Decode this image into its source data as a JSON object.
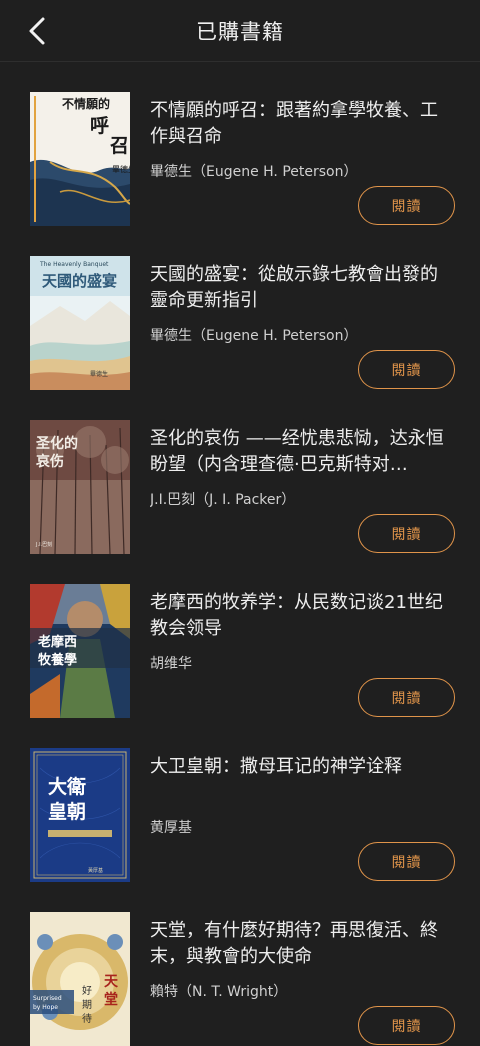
{
  "header": {
    "title": "已購書籍",
    "back_icon": "chevron-left-icon"
  },
  "colors": {
    "background": "#1f1f1f",
    "accent": "#e0944a",
    "text": "#eeeeee"
  },
  "books": [
    {
      "title": "不情願的呼召：跟著約拿學牧養、工作與召命",
      "author": "畢德生（Eugene H. Peterson）",
      "read_label": "閱讀",
      "cover_title": "不情願的呼召"
    },
    {
      "title": "天國的盛宴：從啟示錄七教會出發的靈命更新指引",
      "author": "畢德生（Eugene H. Peterson）",
      "read_label": "閱讀",
      "cover_title": "天國的盛宴",
      "cover_subtitle": "The Heavenly Banquet"
    },
    {
      "title": "圣化的哀伤 ——经忧患悲恸，达永恒盼望（内含理查德·巴克斯特对…",
      "author": "J.I.巴刻（J. I. Packer）",
      "read_label": "閱讀",
      "cover_title": "圣化的哀伤"
    },
    {
      "title": "老摩西的牧养学：从民数记谈21世纪教会领导",
      "author": "胡维华",
      "read_label": "閱讀",
      "cover_title": "老摩西的牧養學"
    },
    {
      "title": "大卫皇朝：撒母耳记的神学诠释",
      "author": "黄厚基",
      "read_label": "閱讀",
      "cover_title": "大衛皇朝"
    },
    {
      "title": "天堂，有什麼好期待？再思復活、終末，與教會的大使命",
      "author": "賴特（N. T. Wright）",
      "read_label": "閱讀",
      "cover_title": "天堂好期待",
      "cover_subtitle": "Surprised by Hope"
    }
  ]
}
